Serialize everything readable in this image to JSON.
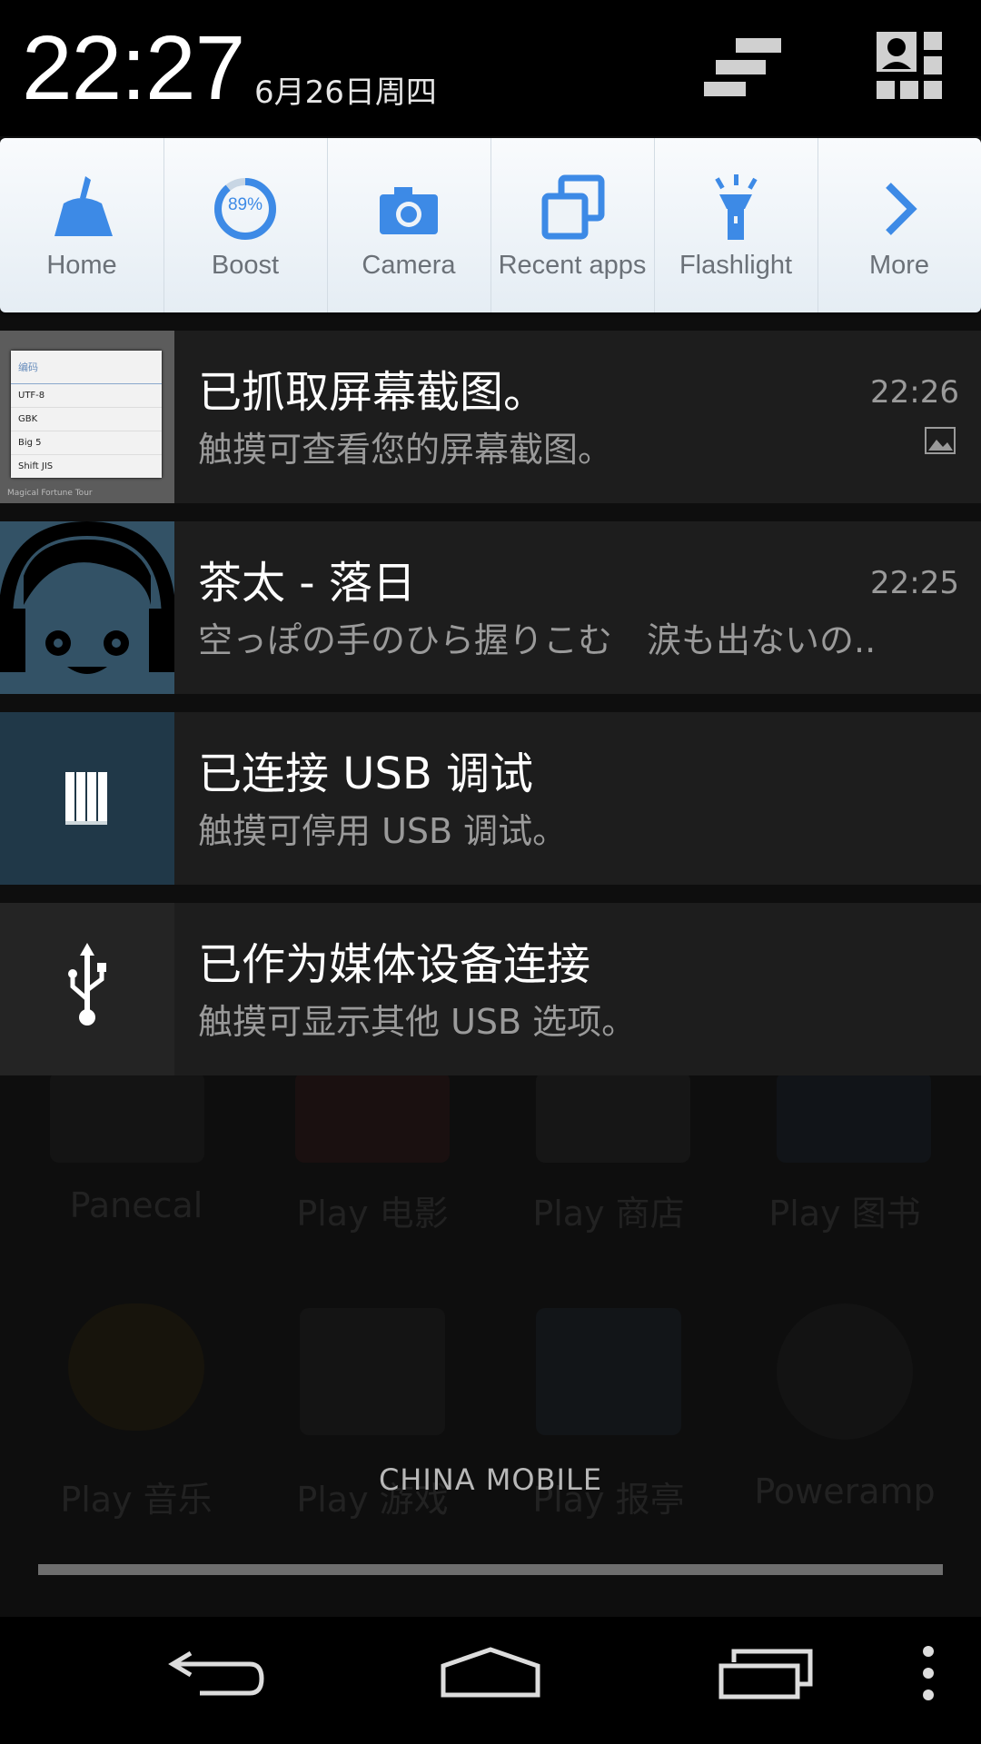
{
  "status": {
    "time": "22:27",
    "date": "6月26日周四"
  },
  "header_icons": [
    {
      "icon": "settings-bars-icon"
    },
    {
      "icon": "quick-settings-user-icon"
    }
  ],
  "quick_settings": [
    {
      "label": "Home",
      "icon": "broom-icon",
      "color": "#3d8ae6"
    },
    {
      "label": "Boost",
      "icon": "boost-gauge-icon",
      "value": "89%",
      "color": "#3d8ae6"
    },
    {
      "label": "Camera",
      "icon": "camera-icon",
      "color": "#3d8ae6"
    },
    {
      "label": "Recent apps",
      "icon": "recent-apps-icon",
      "color": "#3d8ae6"
    },
    {
      "label": "Flashlight",
      "icon": "flashlight-icon",
      "color": "#3d8ae6"
    },
    {
      "label": "More",
      "icon": "chevron-right-icon",
      "color": "#3d8ae6"
    }
  ],
  "notifications": [
    {
      "title": "已抓取屏幕截图。",
      "text": "触摸可查看您的屏幕截图。",
      "time": "22:26",
      "icon": "screenshot-thumbnail",
      "thumb": {
        "menu_title": "编码",
        "menu_items": [
          "UTF-8",
          "GBK",
          "Big 5",
          "Shift JIS"
        ],
        "footer": "Magical Fortune Tour"
      }
    },
    {
      "title": "茶太 - 落日",
      "text": "空っぽの手のひら握りこむ　涙も出ないの..",
      "time": "22:25",
      "icon": "music-headphones-avatar"
    },
    {
      "title": "已连接 USB 调试",
      "text": "触摸可停用 USB 调试。",
      "icon": "usb-debug-icon"
    },
    {
      "title": "已作为媒体设备连接",
      "text": "触摸可显示其他 USB 选项。",
      "icon": "usb-icon"
    }
  ],
  "background_apps": [
    "Panecal",
    "Play 电影",
    "Play 商店",
    "Play 图书",
    "Play 音乐",
    "Play 游戏",
    "Play 报亭",
    "Poweramp"
  ],
  "carrier": "CHINA  MOBILE",
  "navbar": [
    {
      "icon": "back-icon"
    },
    {
      "icon": "home-icon"
    },
    {
      "icon": "recents-icon"
    },
    {
      "icon": "overflow-menu-icon"
    }
  ]
}
